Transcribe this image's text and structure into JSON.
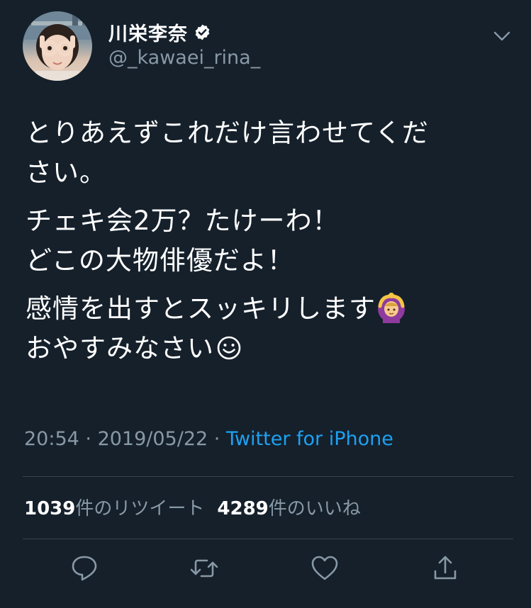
{
  "user": {
    "display_name": "川栄李奈",
    "handle": "@_kawaei_rina_",
    "verified": true
  },
  "tweet": {
    "line1": "とりあえずこれだけ言わせてくだ",
    "line2": "さい。",
    "line3": "チェキ会2万？たけーわ！",
    "line4": "どこの大物俳優だよ！",
    "line5": "感情を出すとスッキリします",
    "line6": "おやすみなさい",
    "emoji_1": "person-gesturing-ok-emoji",
    "emoji_2": "smiling-face-emoji"
  },
  "meta": {
    "time": "20:54",
    "separator": " · ",
    "date": "2019/05/22",
    "source": "Twitter for iPhone"
  },
  "stats": {
    "retweets_count": "1039",
    "retweets_label": "件のリツイート",
    "likes_count": "4289",
    "likes_label": "件のいいね"
  },
  "actions": {
    "reply": "reply-icon",
    "retweet": "retweet-icon",
    "like": "heart-icon",
    "share": "share-icon"
  },
  "colors": {
    "background": "#15202b",
    "text": "#ffffff",
    "secondary": "#8899a6",
    "link": "#1da1f2",
    "divider": "#38444d"
  }
}
